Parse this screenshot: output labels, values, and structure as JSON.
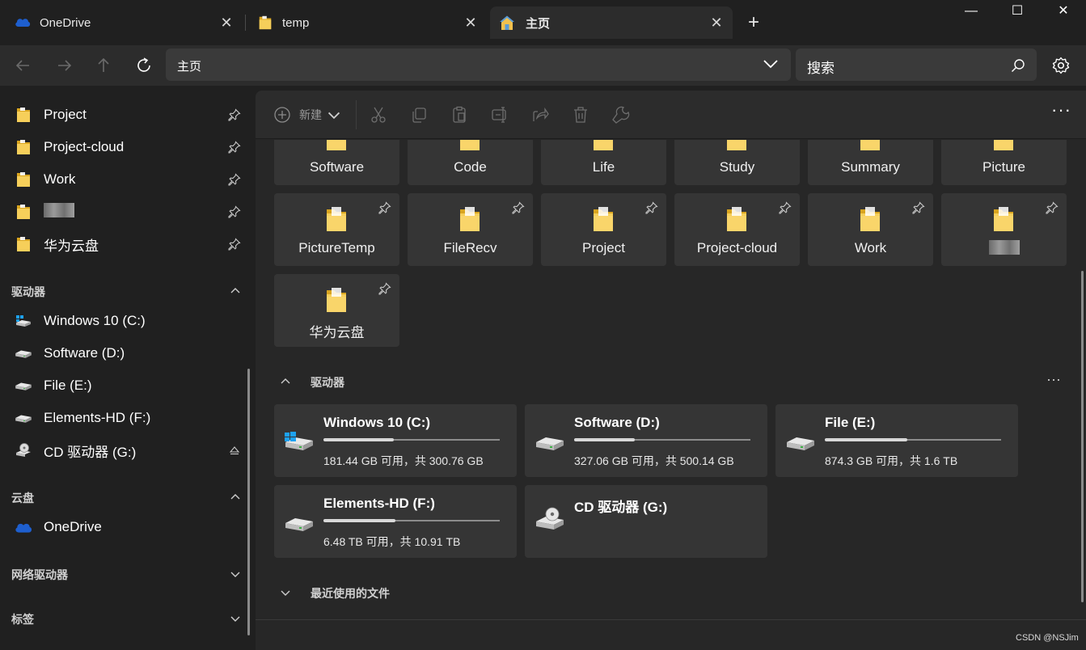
{
  "tabs": [
    {
      "label": "OneDrive",
      "icon": "onedrive-cloud-icon"
    },
    {
      "label": "temp",
      "icon": "folder-icon"
    },
    {
      "label": "主页",
      "icon": "home-icon"
    }
  ],
  "window": {
    "minimize": "—",
    "maximize": "☐",
    "close": "✕"
  },
  "address": {
    "path": "主页"
  },
  "search": {
    "placeholder": "搜索"
  },
  "sidebar": {
    "pinned": [
      {
        "label": "Project"
      },
      {
        "label": "Project-cloud"
      },
      {
        "label": "Work"
      },
      {
        "label": ""
      },
      {
        "label": "华为云盘"
      }
    ],
    "drives_header": "驱动器",
    "drives": [
      {
        "label": "Windows 10 (C:)"
      },
      {
        "label": "Software (D:)"
      },
      {
        "label": "File (E:)"
      },
      {
        "label": "Elements-HD (F:)"
      },
      {
        "label": "CD 驱动器 (G:)"
      }
    ],
    "cloud_header": "云盘",
    "cloud": [
      {
        "label": "OneDrive"
      }
    ],
    "network_header": "网络驱动器",
    "tags_header": "标签"
  },
  "toolbar": {
    "new_label": "新建"
  },
  "quick_access_top": [
    "Software",
    "Code",
    "Life",
    "Study",
    "Summary",
    "Picture"
  ],
  "quick_access": [
    {
      "label": "PictureTemp"
    },
    {
      "label": "FileRecv"
    },
    {
      "label": "Project"
    },
    {
      "label": "Project-cloud"
    },
    {
      "label": "Work"
    },
    {
      "label": ""
    },
    {
      "label": "华为云盘"
    }
  ],
  "drives_section": {
    "title": "驱动器",
    "drives": [
      {
        "name": "Windows 10 (C:)",
        "info": "181.44 GB 可用，共 300.76 GB",
        "used_fraction": 0.397
      },
      {
        "name": "Software (D:)",
        "info": "327.06 GB 可用，共 500.14 GB",
        "used_fraction": 0.346
      },
      {
        "name": "File (E:)",
        "info": "874.3 GB 可用，共 1.6 TB",
        "used_fraction": 0.466
      },
      {
        "name": "Elements-HD (F:)",
        "info": "6.48 TB 可用，共 10.91 TB",
        "used_fraction": 0.406
      },
      {
        "name": "CD 驱动器 (G:)",
        "info": ""
      }
    ]
  },
  "recent_section": {
    "title": "最近使用的文件"
  },
  "watermark": "CSDN @NSJim"
}
